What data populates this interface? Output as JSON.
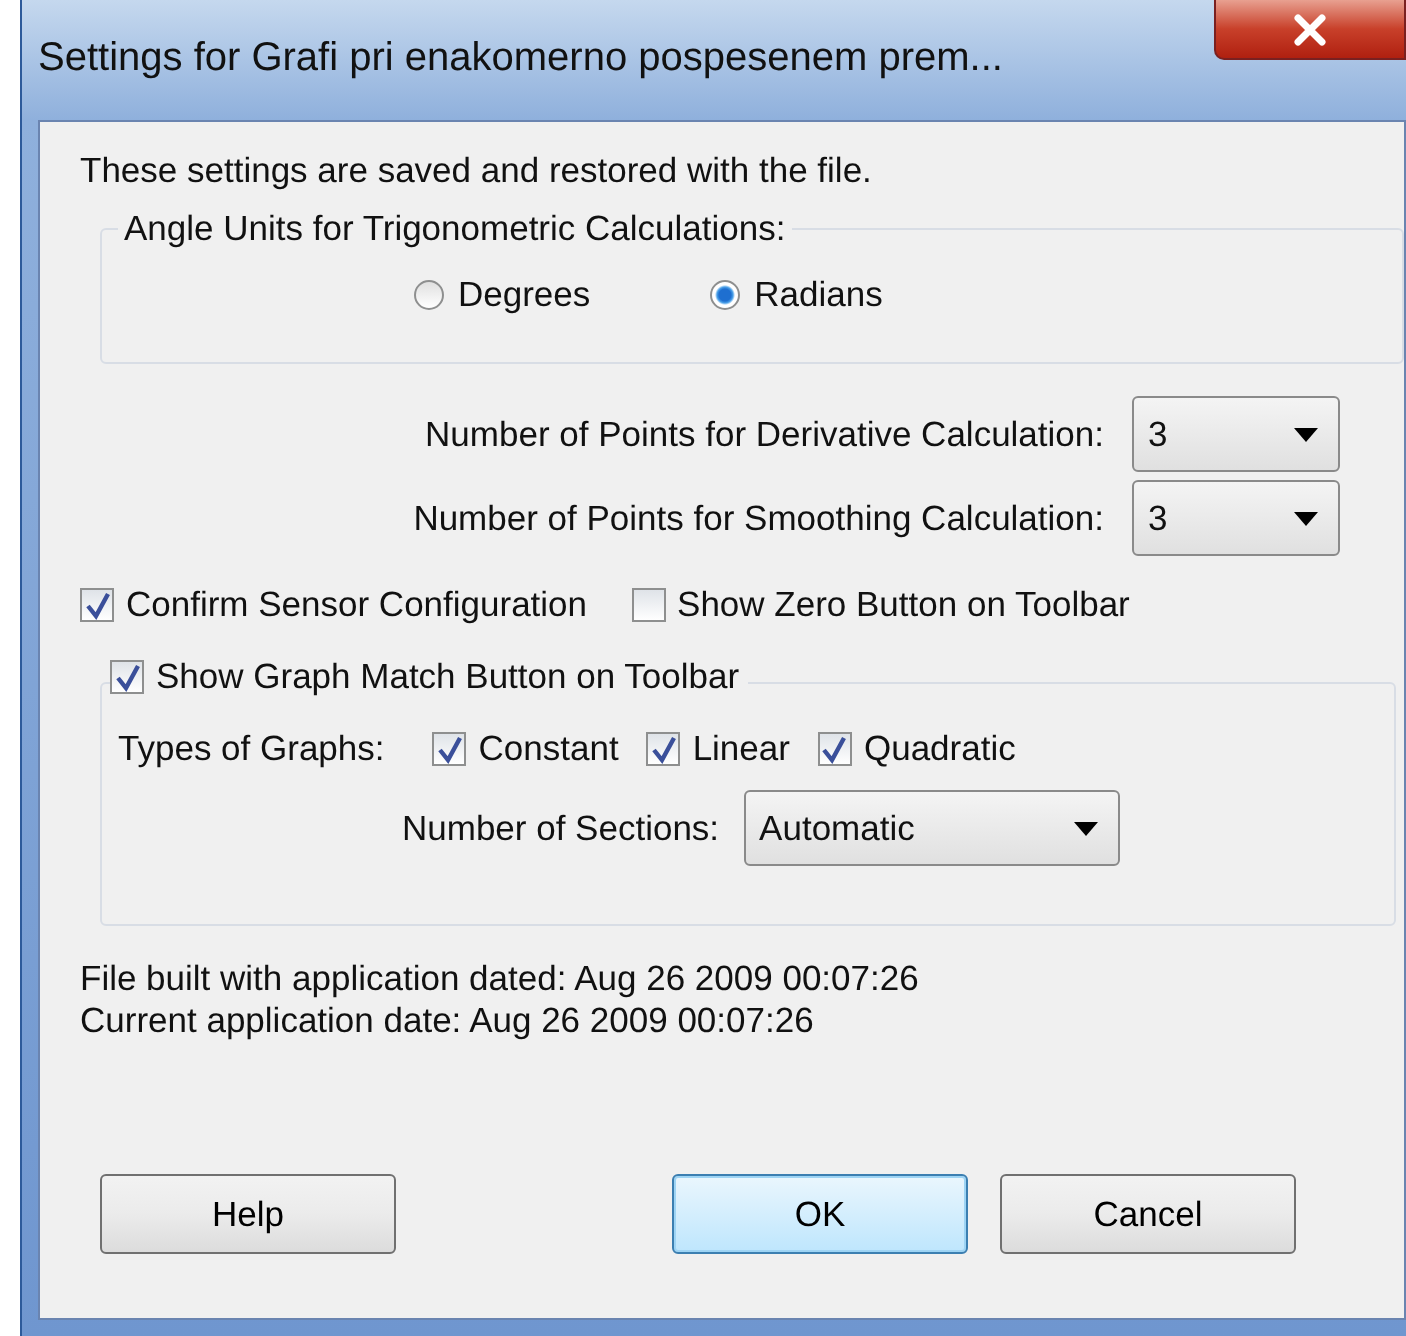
{
  "window": {
    "title": "Settings for Grafi pri enakomerno pospesenem prem..."
  },
  "intro": "These settings are saved and restored with the file.",
  "angle_units": {
    "label": "Angle Units for Trigonometric Calculations:",
    "options": [
      {
        "label": "Degrees",
        "selected": false
      },
      {
        "label": "Radians",
        "selected": true
      }
    ]
  },
  "dropdowns": [
    {
      "label": "Number of Points for Derivative Calculation:",
      "value": "3"
    },
    {
      "label": "Number of Points for Smoothing Calculation:",
      "value": "3"
    }
  ],
  "options": [
    {
      "label": "Confirm Sensor Configuration",
      "checked": true
    },
    {
      "label": "Show Zero Button on Toolbar",
      "checked": false
    }
  ],
  "graph_match": {
    "label": "Show Graph Match Button on Toolbar",
    "checked": true,
    "types_label": "Types of Graphs:",
    "types": [
      {
        "label": "Constant",
        "checked": true
      },
      {
        "label": "Linear",
        "checked": true
      },
      {
        "label": "Quadratic",
        "checked": true
      }
    ],
    "sections": {
      "label": "Number of Sections:",
      "value": "Automatic"
    }
  },
  "info": [
    "File built with application dated: Aug 26 2009 00:07:26",
    "Current application date: Aug 26 2009 00:07:26"
  ],
  "buttons": [
    {
      "label": "Help",
      "default": false
    },
    {
      "label": "OK",
      "default": true
    },
    {
      "label": "Cancel",
      "default": false
    }
  ]
}
